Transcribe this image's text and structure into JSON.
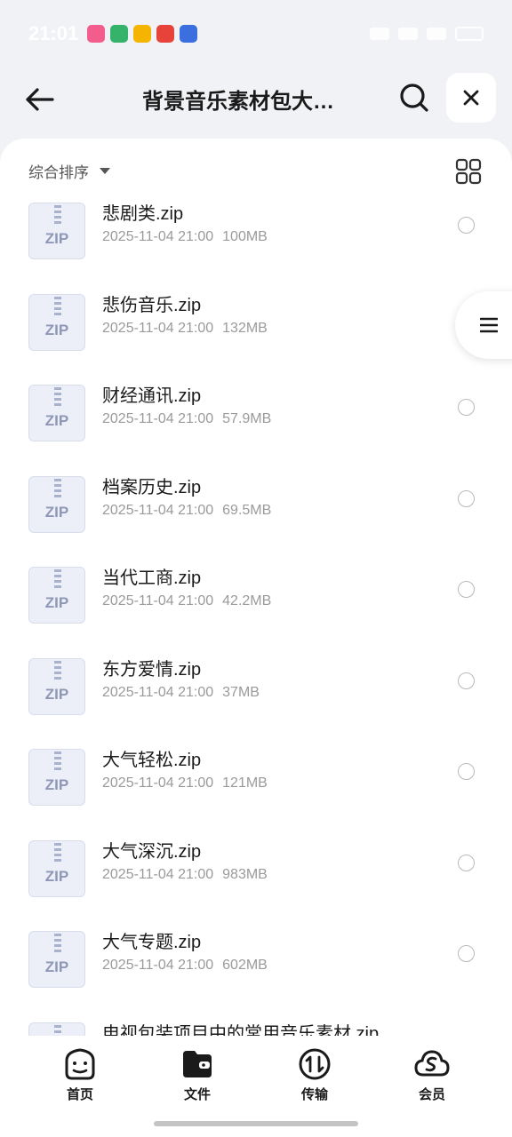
{
  "status_bar": {
    "time": "21:01",
    "apps": [
      {
        "name": "bilibili-app-icon",
        "color": "#f25d8e"
      },
      {
        "name": "green-app-icon",
        "color": "#35b36a"
      },
      {
        "name": "mail-app-icon",
        "color": "#f5b400"
      },
      {
        "name": "red-app-icon",
        "color": "#e8433a"
      },
      {
        "name": "baidu-app-icon",
        "color": "#3b6fe0"
      }
    ]
  },
  "header": {
    "title": "背景音乐素材包大…"
  },
  "toolbar": {
    "sort_label": "综合排序"
  },
  "files": [
    {
      "name": "悲剧类.zip",
      "date": "2025-11-04 21:00",
      "size": "100MB",
      "icon_label": "ZIP"
    },
    {
      "name": "悲伤音乐.zip",
      "date": "2025-11-04 21:00",
      "size": "132MB",
      "icon_label": "ZIP"
    },
    {
      "name": "财经通讯.zip",
      "date": "2025-11-04 21:00",
      "size": "57.9MB",
      "icon_label": "ZIP"
    },
    {
      "name": "档案历史.zip",
      "date": "2025-11-04 21:00",
      "size": "69.5MB",
      "icon_label": "ZIP"
    },
    {
      "name": "当代工商.zip",
      "date": "2025-11-04 21:00",
      "size": "42.2MB",
      "icon_label": "ZIP"
    },
    {
      "name": "东方爱情.zip",
      "date": "2025-11-04 21:00",
      "size": "37MB",
      "icon_label": "ZIP"
    },
    {
      "name": "大气轻松.zip",
      "date": "2025-11-04 21:00",
      "size": "121MB",
      "icon_label": "ZIP"
    },
    {
      "name": "大气深沉.zip",
      "date": "2025-11-04 21:00",
      "size": "983MB",
      "icon_label": "ZIP"
    },
    {
      "name": "大气专题.zip",
      "date": "2025-11-04 21:00",
      "size": "602MB",
      "icon_label": "ZIP"
    },
    {
      "name": "电视包装项目中的常用音乐素材.zip",
      "date": "",
      "size": "",
      "icon_label": "ZIP"
    }
  ],
  "bottom_nav": [
    {
      "label": "首页",
      "icon": "home-face-icon"
    },
    {
      "label": "文件",
      "icon": "folder-icon"
    },
    {
      "label": "传输",
      "icon": "transfer-icon"
    },
    {
      "label": "会员",
      "icon": "vip-cloud-icon"
    }
  ],
  "colors": {
    "background": "#f1f2f5",
    "panel": "#ffffff",
    "zip_icon_bg": "#eceff7",
    "zip_icon_text": "#8e98b6",
    "meta_text": "#9a9a9a"
  }
}
